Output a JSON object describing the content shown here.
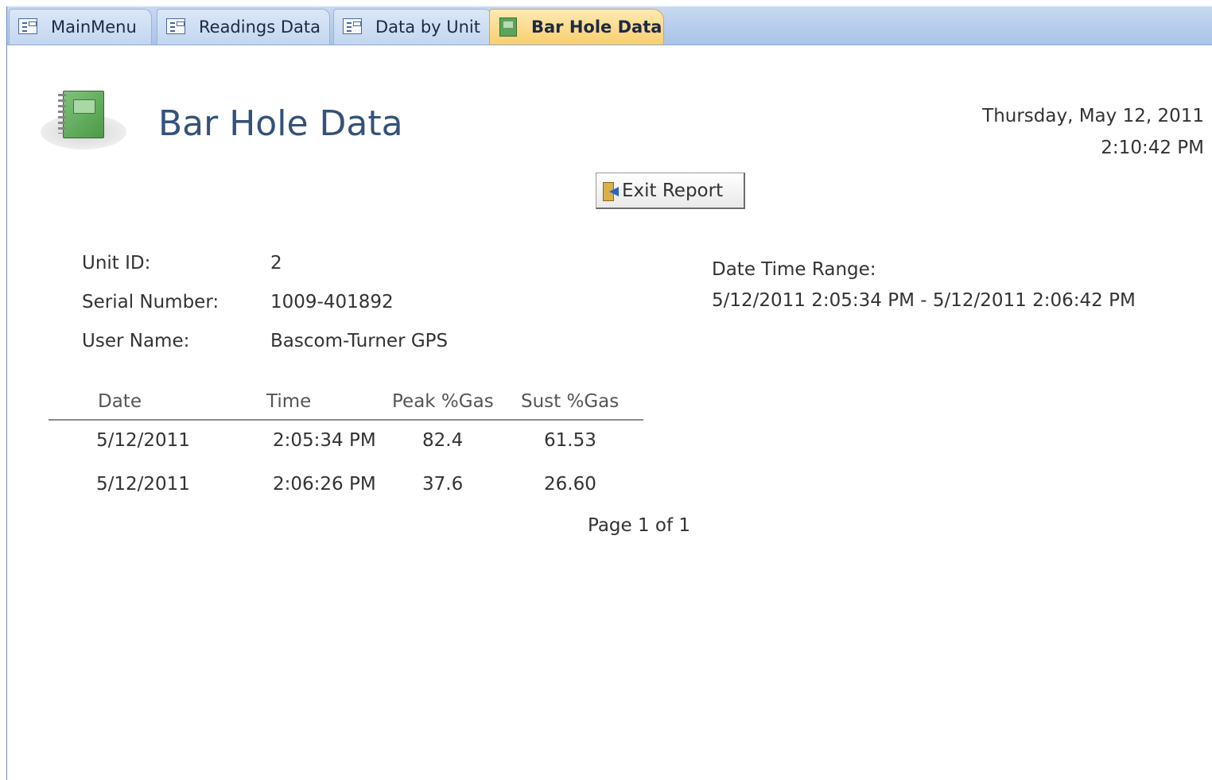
{
  "tabs": [
    {
      "label": "MainMenu",
      "icon": "form-icon",
      "active": false
    },
    {
      "label": "Readings Data",
      "icon": "form-icon",
      "active": false
    },
    {
      "label": "Data by Unit",
      "icon": "form-icon",
      "active": false
    },
    {
      "label": "Bar Hole Data",
      "icon": "report-icon",
      "active": true
    }
  ],
  "report": {
    "title": "Bar Hole Data",
    "date": "Thursday, May 12, 2011",
    "time": "2:10:42 PM",
    "exit_label": "Exit Report",
    "page_footer": "Page 1 of 1"
  },
  "info": {
    "unit_id_label": "Unit ID:",
    "unit_id_value": "2",
    "serial_label": "Serial Number:",
    "serial_value": "1009-401892",
    "user_label": "User Name:",
    "user_value": "Bascom-Turner GPS",
    "range_label": "Date Time Range:",
    "range_value": "5/12/2011 2:05:34 PM - 5/12/2011 2:06:42 PM"
  },
  "table": {
    "columns": [
      "Date",
      "Time",
      "Peak %Gas",
      "Sust %Gas"
    ],
    "rows": [
      [
        "5/12/2011",
        "2:05:34 PM",
        "82.4",
        "61.53"
      ],
      [
        "5/12/2011",
        "2:06:26 PM",
        "37.6",
        "26.60"
      ]
    ]
  },
  "colors": {
    "tabbar": "#b5cbeb",
    "active_tab": "#f9cf6e",
    "title": "#34527a"
  }
}
